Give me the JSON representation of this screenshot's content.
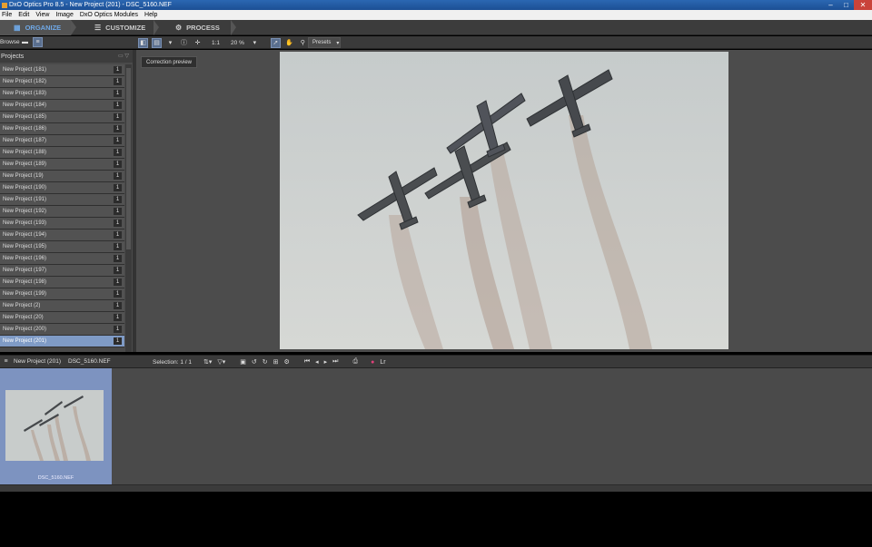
{
  "window": {
    "title": "DxO Optics Pro 8.5 - New Project (201) - DSC_5160.NEF"
  },
  "menu": [
    "File",
    "Edit",
    "View",
    "Image",
    "DxO Optics Modules",
    "Help"
  ],
  "tabs": [
    {
      "label": "ORGANIZE",
      "active": true
    },
    {
      "label": "CUSTOMIZE",
      "active": false
    },
    {
      "label": "PROCESS",
      "active": false
    }
  ],
  "toolbar": {
    "browse_label": "Browse",
    "zoom_1to1": "1:1",
    "zoom_level": "20 %",
    "presets_label": "Presets"
  },
  "tooltip": "Correction preview",
  "projects": {
    "header": "Projects",
    "items": [
      {
        "name": "New Project (181)",
        "count": "1"
      },
      {
        "name": "New Project (182)",
        "count": "1"
      },
      {
        "name": "New Project (183)",
        "count": "1"
      },
      {
        "name": "New Project (184)",
        "count": "1"
      },
      {
        "name": "New Project (185)",
        "count": "1"
      },
      {
        "name": "New Project (186)",
        "count": "1"
      },
      {
        "name": "New Project (187)",
        "count": "1"
      },
      {
        "name": "New Project (188)",
        "count": "1"
      },
      {
        "name": "New Project (189)",
        "count": "1"
      },
      {
        "name": "New Project (19)",
        "count": "1"
      },
      {
        "name": "New Project (190)",
        "count": "1"
      },
      {
        "name": "New Project (191)",
        "count": "1"
      },
      {
        "name": "New Project (192)",
        "count": "1"
      },
      {
        "name": "New Project (193)",
        "count": "1"
      },
      {
        "name": "New Project (194)",
        "count": "1"
      },
      {
        "name": "New Project (195)",
        "count": "1"
      },
      {
        "name": "New Project (196)",
        "count": "1"
      },
      {
        "name": "New Project (197)",
        "count": "1"
      },
      {
        "name": "New Project (198)",
        "count": "1"
      },
      {
        "name": "New Project (199)",
        "count": "1"
      },
      {
        "name": "New Project (2)",
        "count": "1"
      },
      {
        "name": "New Project (20)",
        "count": "1"
      },
      {
        "name": "New Project (200)",
        "count": "1"
      },
      {
        "name": "New Project (201)",
        "count": "1",
        "selected": true
      }
    ]
  },
  "filmstrip": {
    "project_name": "New Project (201)",
    "file_name": "DSC_5160.NEF",
    "selection": "Selection: 1 / 1",
    "thumb_name": "DSC_5160.NEF"
  },
  "colors": {
    "accent": "#6fa8e6",
    "selected_row": "#7f9bc6",
    "panel": "#4a4a4a"
  }
}
